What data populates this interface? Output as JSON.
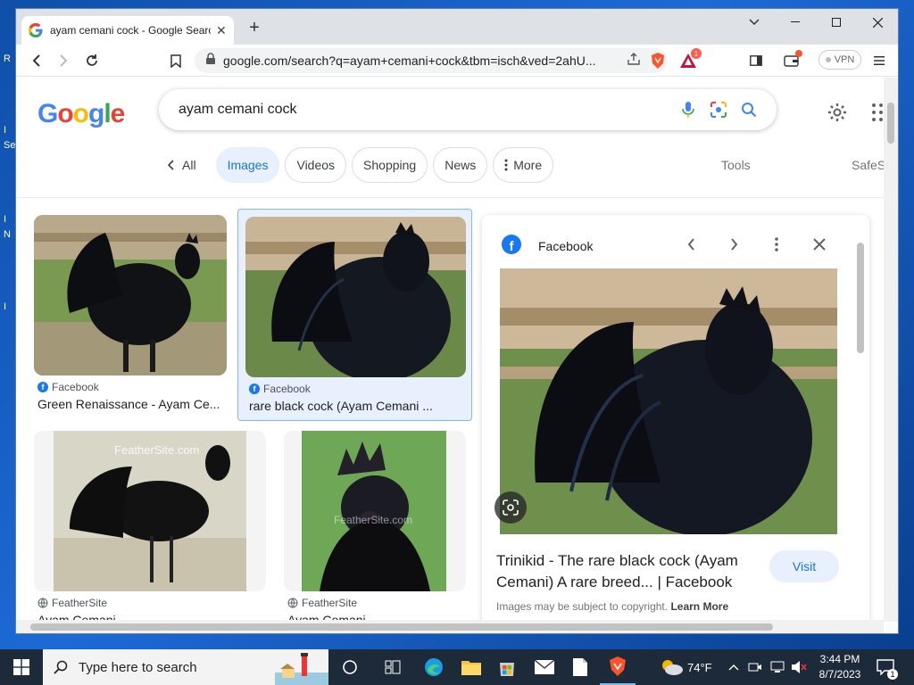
{
  "desktop": {
    "fragments": [
      "R",
      "I",
      "Se",
      "I",
      "N",
      "I"
    ]
  },
  "browser": {
    "tab_title": "ayam cemani cock - Google Search",
    "new_tab_symbol": "+",
    "url": "google.com/search?q=ayam+cemani+cock&tbm=isch&ved=2ahU...",
    "brave_badge": "1",
    "vpn_label": "VPN",
    "window_controls": {
      "minimize": "–",
      "maximize": "☐",
      "close": "✕",
      "dropdown": "⌄"
    }
  },
  "search": {
    "logo_letters": [
      "G",
      "o",
      "o",
      "g",
      "l",
      "e"
    ],
    "query": "ayam cemani cock"
  },
  "filters": {
    "all_label": "All",
    "chips": [
      "Images",
      "Videos",
      "Shopping",
      "News",
      "More"
    ],
    "active": "Images",
    "tools_label": "Tools",
    "safe_label": "SafeS"
  },
  "results": [
    {
      "source": "Facebook",
      "title": "Green Renaissance - Ayam Ce...",
      "source_icon": "facebook-icon"
    },
    {
      "source": "Facebook",
      "title": "rare black cock (Ayam Cemani ...",
      "source_icon": "facebook-icon",
      "selected": true
    },
    {
      "source": "FeatherSite",
      "title": "Ayam Cemani",
      "source_icon": "globe-icon",
      "watermark": "FeatherSite.com"
    },
    {
      "source": "FeatherSite",
      "title": "Ayam Cemani",
      "source_icon": "globe-icon",
      "watermark": "FeatherSite.com"
    }
  ],
  "panel": {
    "site": "Facebook",
    "title": "Trinikid - The rare black cock (Ayam Cemani) A rare breed... | Facebook",
    "visit_label": "Visit",
    "copyright_text": "Images may be subject to copyright.",
    "learn_more": "Learn More"
  },
  "taskbar": {
    "search_placeholder": "Type here to search",
    "weather": "74°F",
    "time": "3:44 PM",
    "date": "8/7/2023",
    "notification_count": "1"
  },
  "colors": {
    "google_blue": "#4285f4",
    "facebook_blue": "#1877f2",
    "active_chip_bg": "#e8f0fe",
    "active_chip_text": "#1a73e8",
    "brave_orange": "#fb542b"
  }
}
